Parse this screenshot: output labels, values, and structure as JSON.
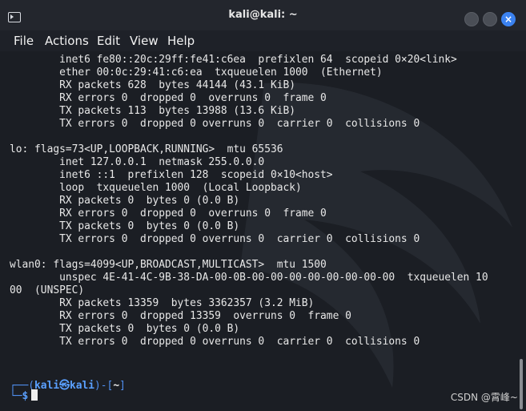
{
  "window": {
    "title": "kali@kali: ~",
    "close_glyph": "×"
  },
  "menu": [
    "File",
    "Actions",
    "Edit",
    "View",
    "Help"
  ],
  "terminal": {
    "lines": [
      "        inet6 fe80::20c:29ff:fe41:c6ea  prefixlen 64  scopeid 0×20<link>",
      "        ether 00:0c:29:41:c6:ea  txqueuelen 1000  (Ethernet)",
      "        RX packets 628  bytes 44144 (43.1 KiB)",
      "        RX errors 0  dropped 0  overruns 0  frame 0",
      "        TX packets 113  bytes 13988 (13.6 KiB)",
      "        TX errors 0  dropped 0 overruns 0  carrier 0  collisions 0",
      "",
      "lo: flags=73<UP,LOOPBACK,RUNNING>  mtu 65536",
      "        inet 127.0.0.1  netmask 255.0.0.0",
      "        inet6 ::1  prefixlen 128  scopeid 0×10<host>",
      "        loop  txqueuelen 1000  (Local Loopback)",
      "        RX packets 0  bytes 0 (0.0 B)",
      "        RX errors 0  dropped 0  overruns 0  frame 0",
      "        TX packets 0  bytes 0 (0.0 B)",
      "        TX errors 0  dropped 0 overruns 0  carrier 0  collisions 0",
      "",
      "wlan0: flags=4099<UP,BROADCAST,MULTICAST>  mtu 1500",
      "        unspec 4E-41-4C-9B-38-DA-00-0B-00-00-00-00-00-00-00-00  txqueuelen 10",
      "00  (UNSPEC)",
      "        RX packets 13359  bytes 3362357 (3.2 MiB)",
      "        RX errors 0  dropped 13359  overruns 0  frame 0",
      "        TX packets 0  bytes 0 (0.0 B)",
      "        TX errors 0  dropped 0 overruns 0  carrier 0  collisions 0"
    ],
    "prompt": {
      "open": "┌──(",
      "user": "kali",
      "at": "㉿",
      "host": "kali",
      "mid": ")-[",
      "path": "~",
      "close": "]",
      "line2": "└─",
      "dollar": "$"
    }
  },
  "watermark_text": "CSDN @霄峰~",
  "colors": {
    "prompt_blue": "#5aa0ff",
    "close_button": "#3b82f0",
    "background": "#1b1e24"
  }
}
